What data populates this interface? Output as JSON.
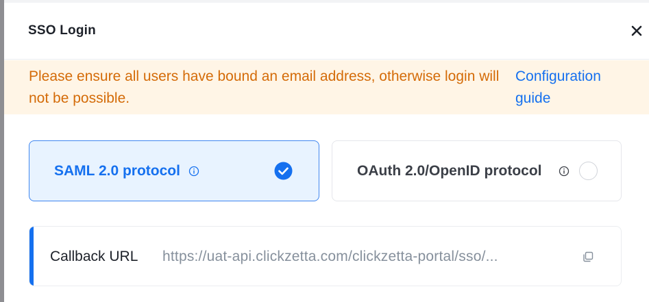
{
  "dialog": {
    "title": "SSO Login",
    "close_icon": "close-icon"
  },
  "alert": {
    "message": "Please ensure all users have bound an email address, otherwise login will not be possible.",
    "link": "Configuration guide"
  },
  "protocols": [
    {
      "label": "SAML 2.0 protocol",
      "selected": true,
      "info_icon": "info-icon",
      "state_icon": "check-circle-icon"
    },
    {
      "label": "OAuth 2.0/OpenID protocol",
      "selected": false,
      "info_icon": "info-icon",
      "state_icon": "radio-icon"
    }
  ],
  "callback": {
    "label": "Callback URL",
    "url": "https://uat-api.clickzetta.com/clickzetta-portal/sso/...",
    "copy_icon": "copy-icon"
  },
  "colors": {
    "accent": "#1570ef",
    "alert_bg": "#fff5e6",
    "alert_text": "#d46b08",
    "selected_bg": "#e8f3ff"
  }
}
